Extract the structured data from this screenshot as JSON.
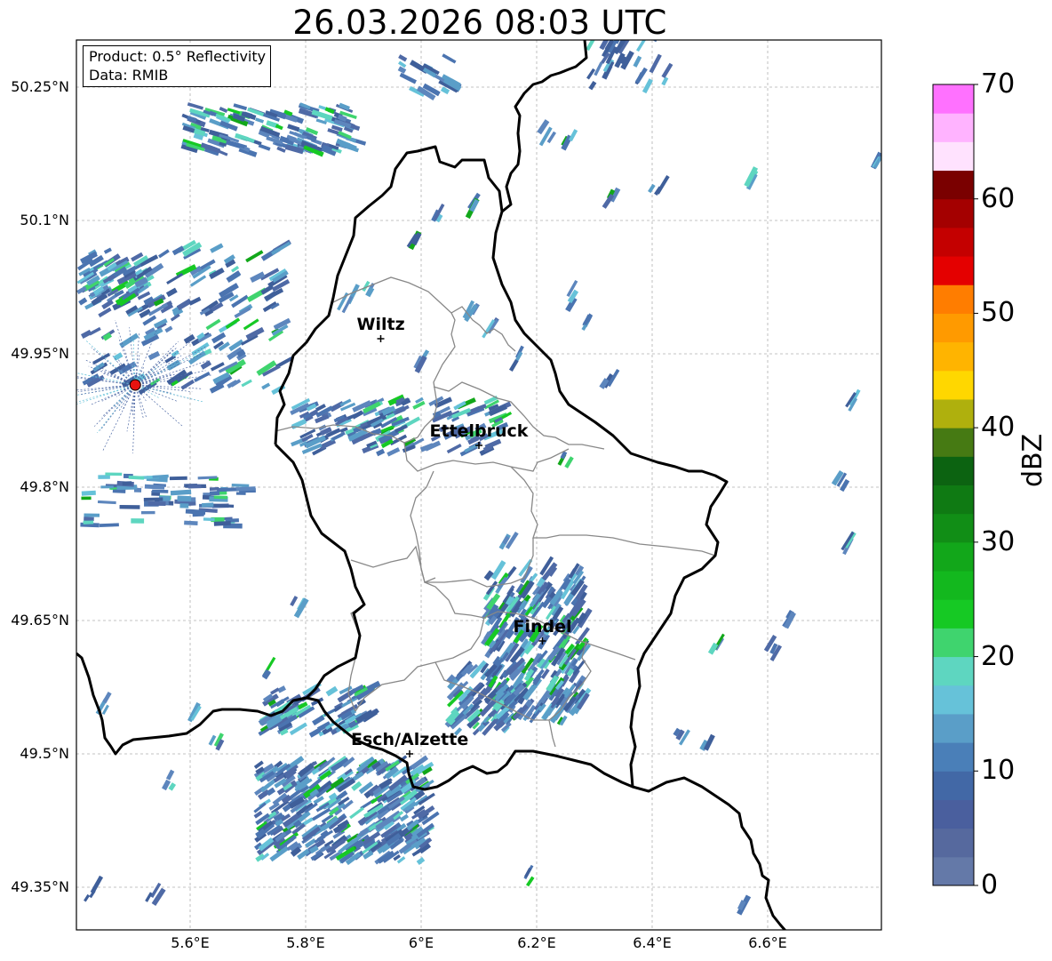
{
  "title": "26.03.2026 08:03 UTC",
  "info": {
    "product": "Product: 0.5° Reflectivity",
    "data": "Data: RMIB"
  },
  "lat_labels": [
    "50.25°N",
    "50.1°N",
    "49.95°N",
    "49.8°N",
    "49.65°N",
    "49.5°N",
    "49.35°N"
  ],
  "lon_labels": [
    "5.6°E",
    "5.8°E",
    "6°E",
    "6.2°E",
    "6.4°E",
    "6.6°E"
  ],
  "cities": [
    {
      "name": "Wiltz",
      "lon": 5.93,
      "lat": 49.967
    },
    {
      "name": "Ettelbruck",
      "lon": 6.1,
      "lat": 49.847
    },
    {
      "name": "Findel",
      "lon": 6.21,
      "lat": 49.627
    },
    {
      "name": "Esch/Alzette",
      "lon": 5.98,
      "lat": 49.5
    }
  ],
  "radar_site": {
    "lon": 5.505,
    "lat": 49.915
  },
  "colorbar": {
    "label": "dBZ",
    "min": 0,
    "max": 70,
    "step": 2.5,
    "ticks": [
      "0",
      "10",
      "20",
      "30",
      "40",
      "50",
      "60",
      "70"
    ],
    "colors": [
      "#6479a8",
      "#56699e",
      "#4a5f9e",
      "#4268a6",
      "#4a7fb8",
      "#5a9ec8",
      "#66c2d9",
      "#5ed6c0",
      "#3fd46e",
      "#16c924",
      "#13b81e",
      "#12a71a",
      "#118e16",
      "#0f7a13",
      "#0c6311",
      "#467a13",
      "#afb00d",
      "#ffd700",
      "#ffb400",
      "#ff9a00",
      "#ff7d00",
      "#e40000",
      "#c40000",
      "#a40000",
      "#7a0000",
      "#ffe2fe",
      "#ffb3ff",
      "#ff71ff",
      "#ea3cf3"
    ]
  }
}
